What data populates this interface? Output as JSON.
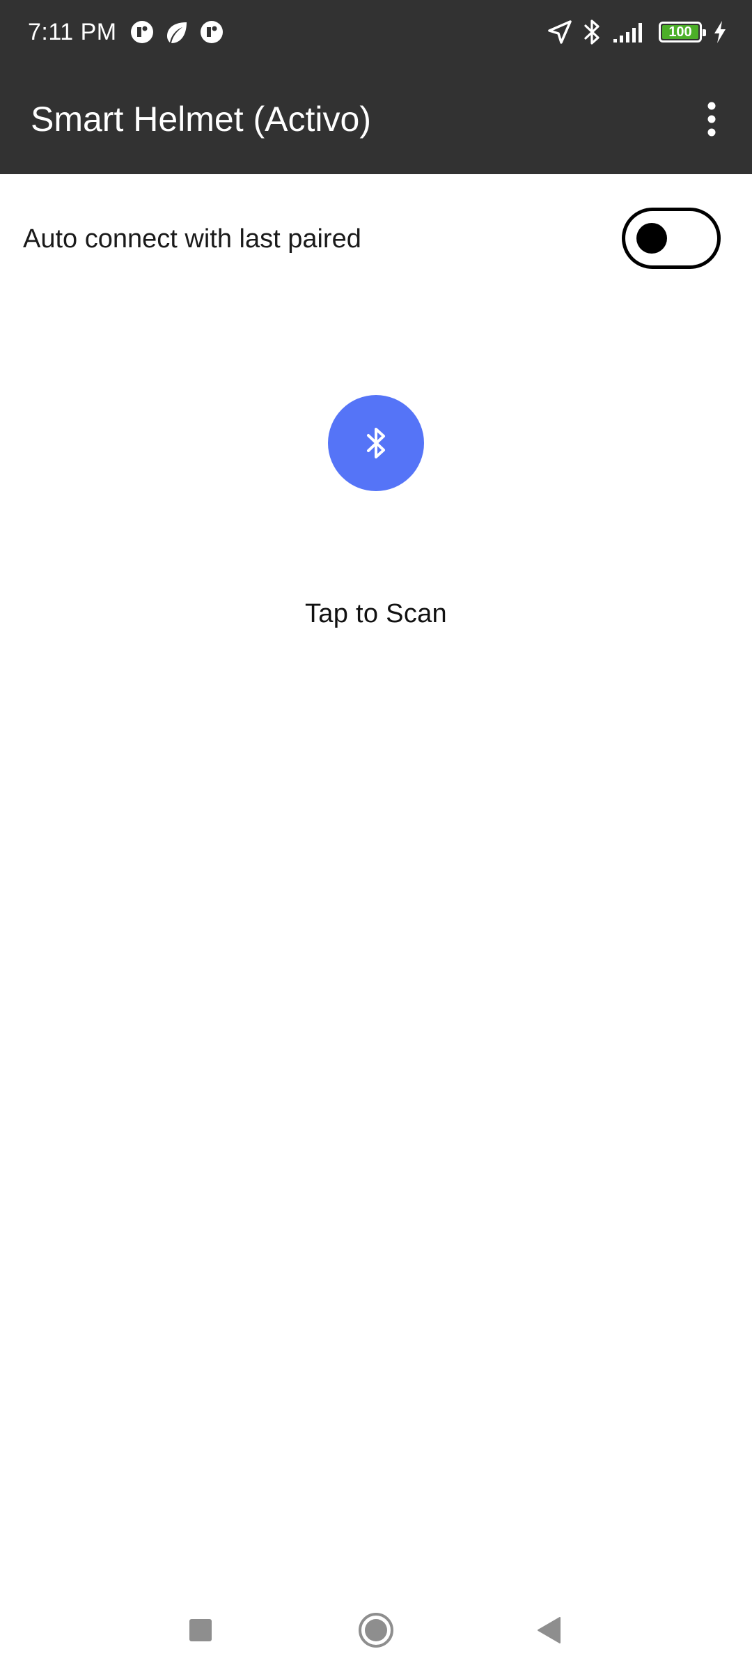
{
  "status_bar": {
    "time": "7:11 PM",
    "battery_level": "100",
    "notification_icons": [
      "circle-app-icon",
      "leaf-icon",
      "circle-app-icon"
    ],
    "system_icons": [
      "location-icon",
      "bluetooth-icon",
      "signal-icon",
      "battery-icon",
      "charging-icon"
    ],
    "battery_color": "#4caf28"
  },
  "app_bar": {
    "title": "Smart Helmet (Activo)",
    "menu_icon": "more-vert-icon",
    "background": "#323232"
  },
  "auto_connect": {
    "label": "Auto connect with last paired",
    "enabled": false
  },
  "scan": {
    "icon": "bluetooth-icon",
    "label": "Tap to Scan",
    "button_color": "#5574f7"
  },
  "nav_bar": {
    "buttons": [
      "recents-icon",
      "home-icon",
      "back-icon"
    ]
  }
}
